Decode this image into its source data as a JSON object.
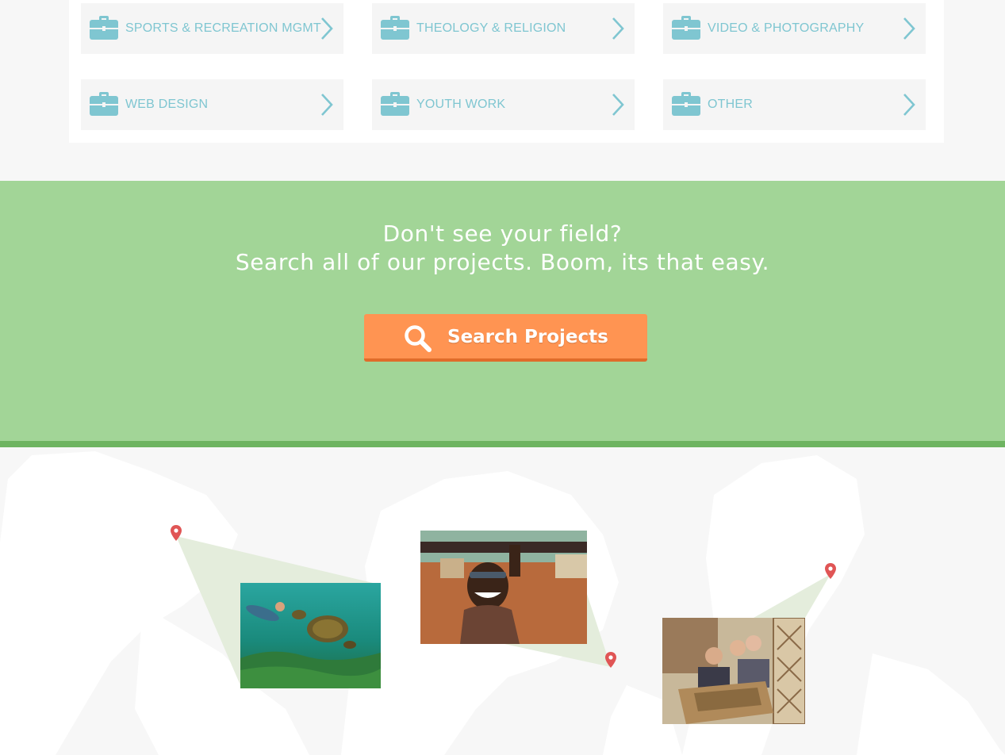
{
  "categories": [
    {
      "label": "SPORTS & RECREATION MGMT",
      "icon": "briefcase-icon"
    },
    {
      "label": "THEOLOGY & RELIGION",
      "icon": "briefcase-icon"
    },
    {
      "label": "VIDEO & PHOTOGRAPHY",
      "icon": "briefcase-icon"
    },
    {
      "label": "WEB DESIGN",
      "icon": "briefcase-icon"
    },
    {
      "label": "YOUTH WORK",
      "icon": "briefcase-icon"
    },
    {
      "label": "OTHER",
      "icon": "briefcase-icon"
    }
  ],
  "cta": {
    "line1": "Don't see your field?",
    "line2": "Search all of our projects. Boom, its that easy.",
    "button_label": "Search Projects",
    "button_icon": "search-icon"
  },
  "map": {
    "pin_icon": "map-pin-icon",
    "photos": [
      {
        "name": "photo-turtle-snorkel"
      },
      {
        "name": "photo-smiling-man"
      },
      {
        "name": "photo-architecture-students"
      }
    ]
  },
  "colors": {
    "category_text": "#7fc6d1",
    "cta_background": "#a2d597",
    "cta_border": "#6eb461",
    "button": "#ff9452",
    "button_shadow": "#e06c2a",
    "pin": "#e05555",
    "callout": "#e4eddc"
  }
}
